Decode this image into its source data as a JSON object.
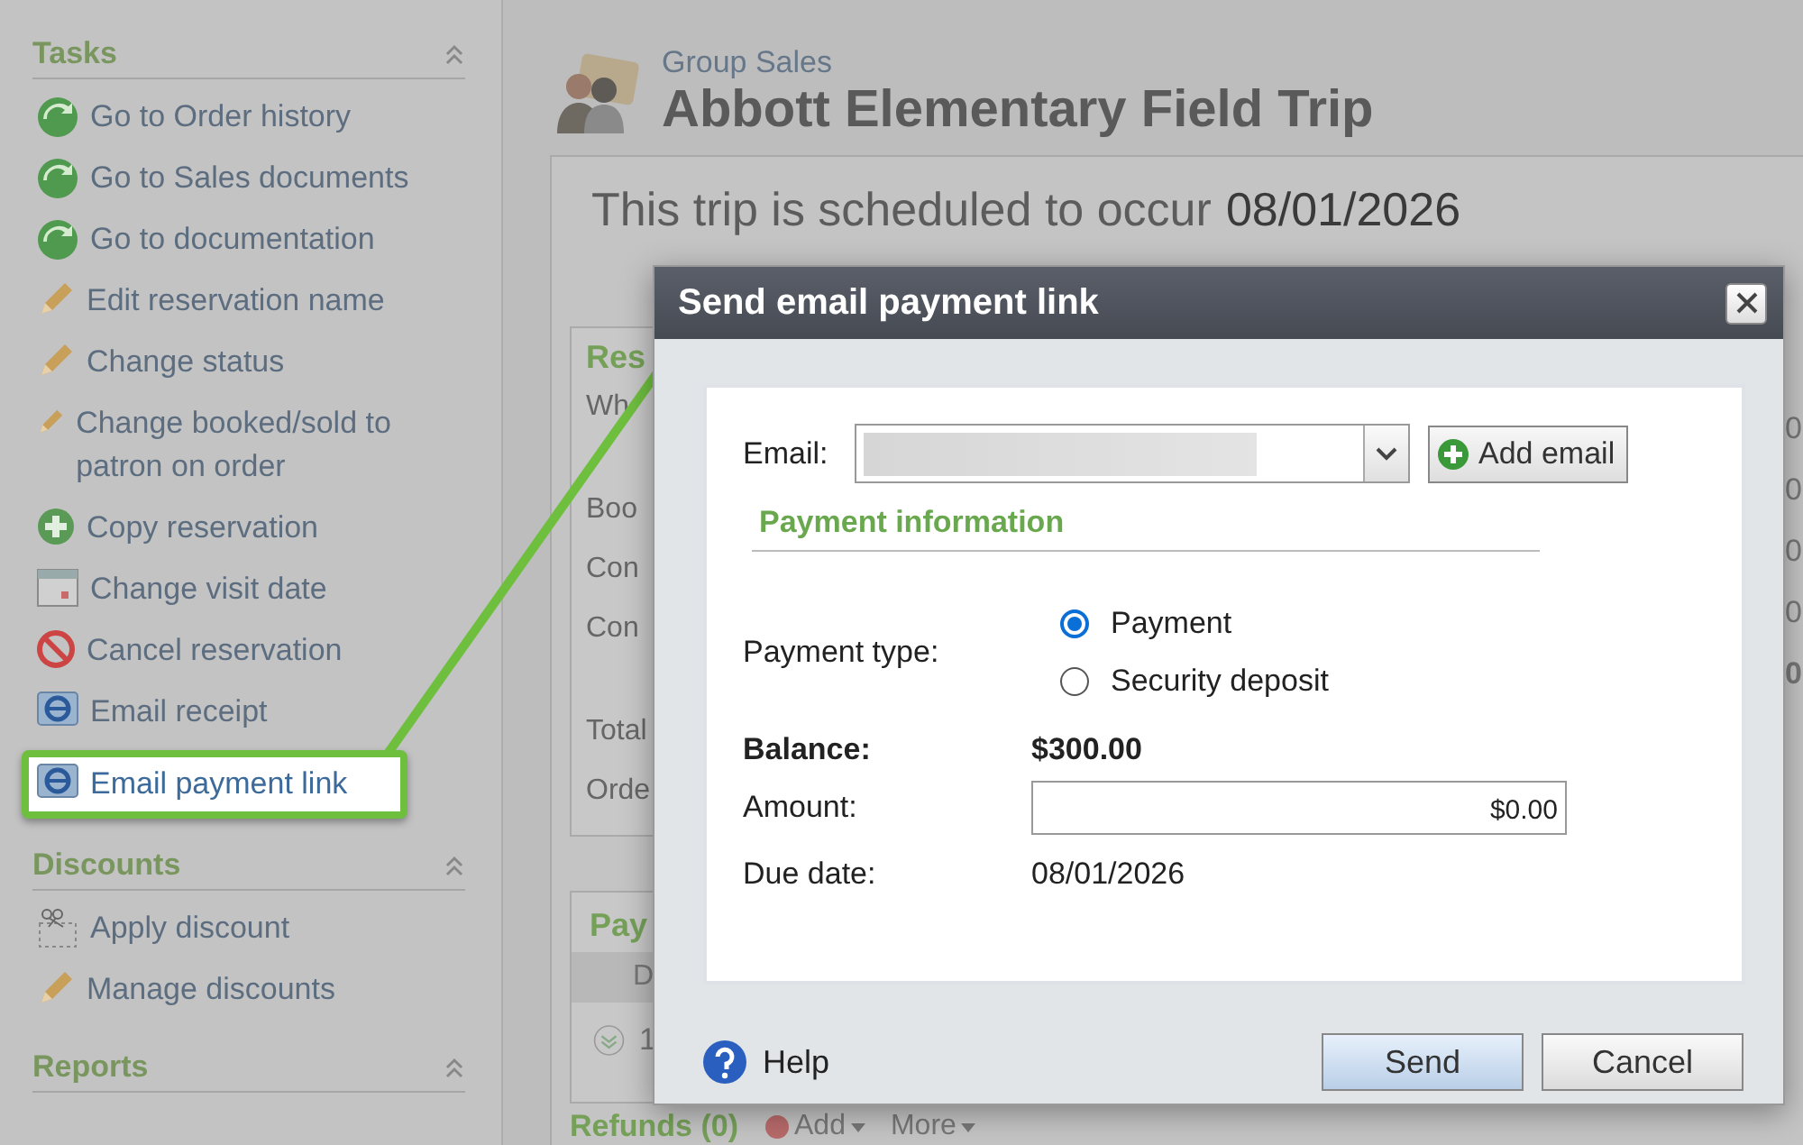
{
  "sidebar": {
    "sections": [
      {
        "title": "Tasks",
        "items": [
          {
            "label": "Go to Order history",
            "kind": "go",
            "highlighted": false
          },
          {
            "label": "Go to Sales documents",
            "kind": "go",
            "highlighted": false
          },
          {
            "label": "Go to documentation",
            "kind": "go",
            "highlighted": false
          },
          {
            "label": "Edit reservation name",
            "kind": "edit",
            "highlighted": false
          },
          {
            "label": "Change status",
            "kind": "edit",
            "highlighted": false
          },
          {
            "label": "Change booked/sold to patron on order",
            "kind": "edit",
            "highlighted": false
          },
          {
            "label": "Copy reservation",
            "kind": "add",
            "highlighted": false
          },
          {
            "label": "Change visit date",
            "kind": "date",
            "highlighted": false
          },
          {
            "label": "Cancel reservation",
            "kind": "cancel",
            "highlighted": false
          },
          {
            "label": "Email receipt",
            "kind": "email",
            "highlighted": false
          },
          {
            "label": "Email payment link",
            "kind": "email",
            "highlighted": true
          }
        ]
      },
      {
        "title": "Discounts",
        "items": [
          {
            "label": "Apply discount",
            "kind": "discount",
            "highlighted": false
          },
          {
            "label": "Manage discounts",
            "kind": "edit",
            "highlighted": false
          }
        ]
      },
      {
        "title": "Reports"
      }
    ]
  },
  "header": {
    "breadcrumb": "Group Sales",
    "title": "Abbott Elementary Field Trip"
  },
  "schedule": {
    "text": "This trip is scheduled to occur",
    "date": "08/01/2026"
  },
  "background": {
    "reservation_title": "Res",
    "reservation_labels": [
      "Wh",
      "Boo",
      "Con",
      "Con",
      "Total",
      "Orde"
    ],
    "right_values": [
      "0",
      "0",
      "0",
      "0",
      "0"
    ],
    "payments_title": "Pay",
    "payments_column": "D",
    "payments_row": "1",
    "refunds_title": "Refunds (0)",
    "refunds_add": "Add",
    "refunds_more": "More"
  },
  "dialog": {
    "title": "Send email payment link",
    "email": {
      "label": "Email:",
      "button": "Add email"
    },
    "section_title": "Payment information",
    "payment_type": {
      "label": "Payment type:",
      "options": [
        {
          "label": "Payment",
          "selected": true
        },
        {
          "label": "Security deposit",
          "selected": false
        }
      ]
    },
    "balance": {
      "label": "Balance:",
      "value": "$300.00"
    },
    "amount": {
      "label": "Amount:",
      "value": "$0.00"
    },
    "due_date": {
      "label": "Due date:",
      "value": "08/01/2026"
    },
    "help": "Help",
    "buttons": [
      {
        "label": "Send",
        "kind": "primary"
      },
      {
        "label": "Cancel",
        "kind": "secondary"
      }
    ]
  }
}
